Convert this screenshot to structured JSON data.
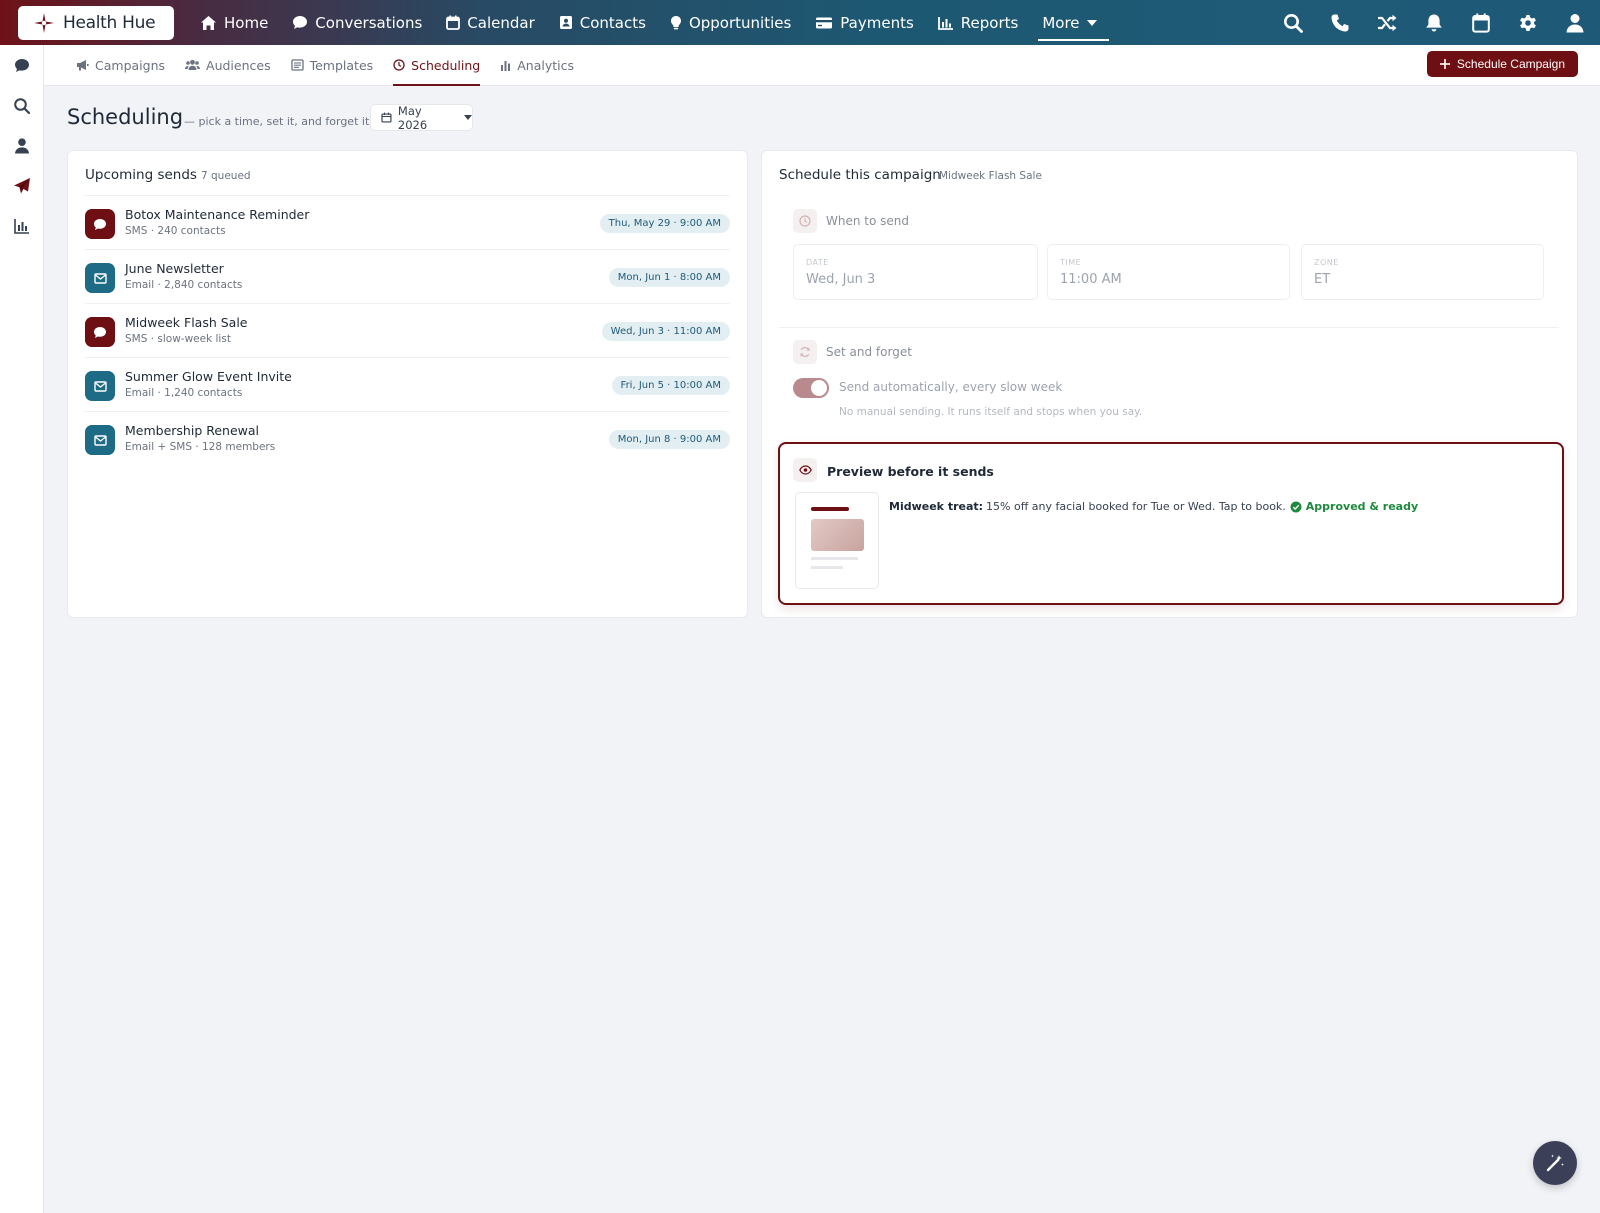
{
  "brand": {
    "name": "Health Hue"
  },
  "topnav": {
    "items": [
      {
        "label": "Home",
        "icon": "home-icon"
      },
      {
        "label": "Conversations",
        "icon": "chat-bubble-icon"
      },
      {
        "label": "Calendar",
        "icon": "calendar-icon"
      },
      {
        "label": "Contacts",
        "icon": "contact-card-icon"
      },
      {
        "label": "Opportunities",
        "icon": "lightbulb-icon"
      },
      {
        "label": "Payments",
        "icon": "credit-card-icon"
      },
      {
        "label": "Reports",
        "icon": "bar-chart-icon"
      }
    ],
    "more_label": "More",
    "right_icons": [
      "search-icon",
      "phone-icon",
      "shuffle-icon",
      "bell-icon",
      "calendar-icon",
      "gear-icon",
      "user-icon"
    ]
  },
  "rail": {
    "icons": [
      "chat-bubble-icon",
      "search-icon",
      "user-icon",
      "paper-plane-icon",
      "bar-chart-icon"
    ]
  },
  "subnav": {
    "tabs": [
      {
        "label": "Campaigns",
        "icon": "megaphone-icon"
      },
      {
        "label": "Audiences",
        "icon": "users-icon"
      },
      {
        "label": "Templates",
        "icon": "template-icon"
      },
      {
        "label": "Scheduling",
        "icon": "clock-icon",
        "active": true
      },
      {
        "label": "Analytics",
        "icon": "bar-chart-icon"
      }
    ],
    "primary_button": "Schedule Campaign"
  },
  "page": {
    "title": "Scheduling",
    "subtitle": "— pick a time, set it, and forget it",
    "month": "May 2026"
  },
  "upcoming": {
    "title": "Upcoming sends",
    "count": "7 queued",
    "items": [
      {
        "name": "Botox Maintenance Reminder",
        "meta": "SMS · 240 contacts",
        "time": "Thu, May 29 · 9:00 AM",
        "channel": "sms"
      },
      {
        "name": "June Newsletter",
        "meta": "Email · 2,840 contacts",
        "time": "Mon, Jun 1 · 8:00 AM",
        "channel": "email"
      },
      {
        "name": "Midweek Flash Sale",
        "meta": "SMS · slow-week list",
        "time": "Wed, Jun 3 · 11:00 AM",
        "channel": "sms"
      },
      {
        "name": "Summer Glow Event Invite",
        "meta": "Email · 1,240 contacts",
        "time": "Fri, Jun 5 · 10:00 AM",
        "channel": "email"
      },
      {
        "name": "Membership Renewal",
        "meta": "Email + SMS · 128 members",
        "time": "Mon, Jun 8 · 9:00 AM",
        "channel": "email"
      }
    ]
  },
  "schedule": {
    "title": "Schedule this campaign",
    "campaign_name": "Midweek Flash Sale",
    "when": {
      "label": "When to send",
      "date_label": "DATE",
      "date_value": "Wed, Jun 3",
      "time_label": "TIME",
      "time_value": "11:00 AM",
      "zone_label": "ZONE",
      "zone_value": "ET"
    },
    "set_forget": {
      "label": "Set and forget",
      "toggle_label": "Send automatically, every slow week",
      "help": "No manual sending. It runs itself and stops when you say.",
      "enabled": true
    },
    "preview": {
      "title": "Preview before it sends",
      "lead": "Midweek treat:",
      "message": "15% off any facial booked for Tue or Wed. Tap to book.",
      "status": "Approved & ready"
    }
  },
  "colors": {
    "brand": "#6e0f14",
    "teal": "#1e6b86",
    "success": "#1f8a3f"
  }
}
